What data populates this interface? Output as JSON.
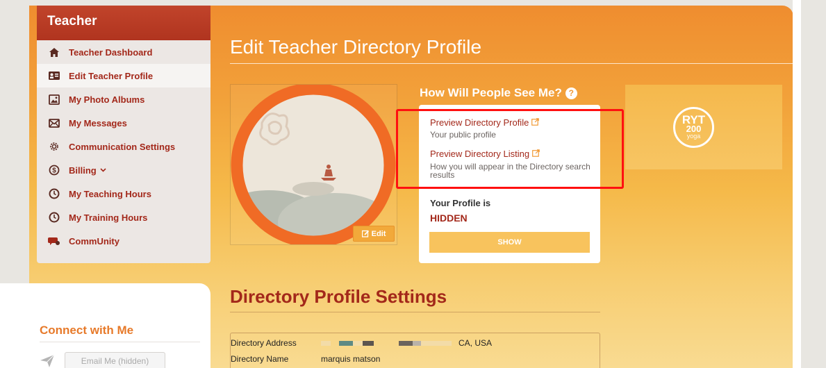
{
  "sidebar": {
    "title": "Teacher",
    "items": [
      {
        "label": "Teacher Dashboard",
        "icon": "home-icon"
      },
      {
        "label": "Edit Teacher Profile",
        "icon": "id-card-icon"
      },
      {
        "label": "My Photo Albums",
        "icon": "photo-icon"
      },
      {
        "label": "My Messages",
        "icon": "envelope-icon"
      },
      {
        "label": "Communication Settings",
        "icon": "gear-icon"
      },
      {
        "label": "Billing",
        "icon": "dollar-icon"
      },
      {
        "label": "My Teaching Hours",
        "icon": "clock-icon"
      },
      {
        "label": "My Training Hours",
        "icon": "clock-icon"
      },
      {
        "label": "CommUnity",
        "icon": "chat-icon"
      }
    ]
  },
  "page_title": "Edit Teacher Directory Profile",
  "photo": {
    "edit_label": "Edit"
  },
  "visibility_card": {
    "title": "How Will People See Me?",
    "help_glyph": "?",
    "preview_profile_label": "Preview Directory Profile",
    "preview_profile_desc": "Your public profile",
    "preview_listing_label": "Preview Directory Listing",
    "preview_listing_desc": "How you will appear in the Directory search results",
    "status_label": "Your Profile is",
    "status_value": "HIDDEN",
    "show_button": "SHOW"
  },
  "badge": {
    "line1": "RYT",
    "line2": "200",
    "line3": "yoga"
  },
  "directory_settings": {
    "title": "Directory Profile Settings",
    "address_label": "Directory Address",
    "address_value": "CA, USA",
    "name_label": "Directory Name",
    "name_value": "marquis matson"
  },
  "connect": {
    "title": "Connect with Me",
    "email_button": "Email Me",
    "email_hidden": "(hidden)"
  },
  "colors": {
    "accent_red": "#a3281a",
    "orange": "#ef8d2f",
    "highlight": "#ff1010"
  }
}
